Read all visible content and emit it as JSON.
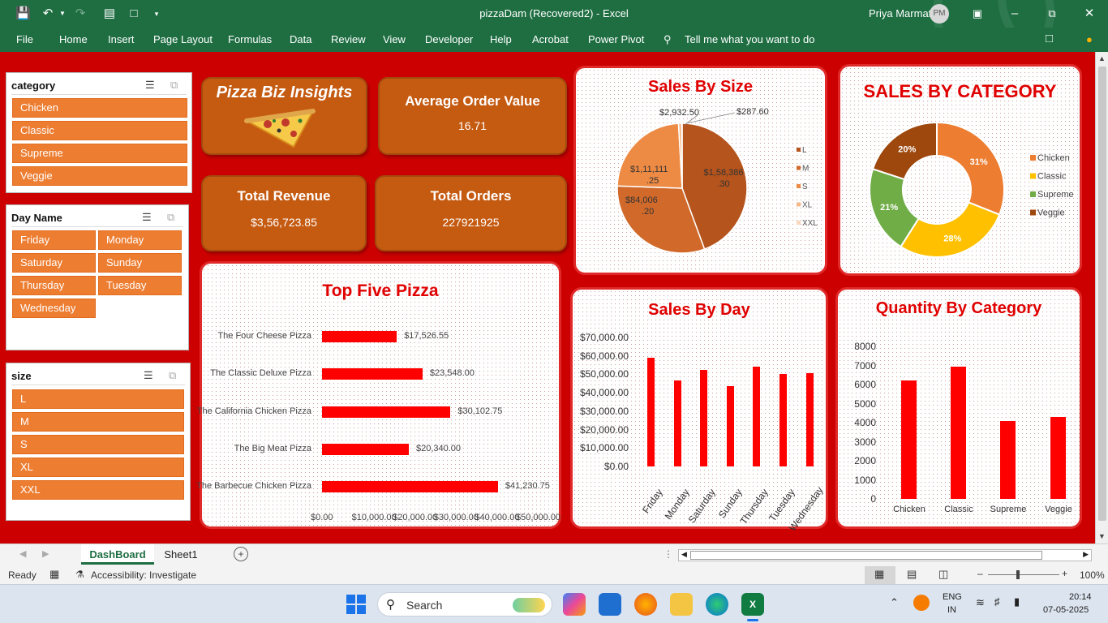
{
  "window": {
    "title": "pizzaDam (Recovered2) - Excel",
    "user": "Priya Marmat",
    "initials": "PM"
  },
  "menu": [
    "File",
    "Home",
    "Insert",
    "Page Layout",
    "Formulas",
    "Data",
    "Review",
    "View",
    "Developer",
    "Help",
    "Acrobat",
    "Power Pivot",
    "Tell me what you want to do"
  ],
  "slicers": {
    "category": {
      "title": "category",
      "items": [
        "Chicken",
        "Classic",
        "Supreme",
        "Veggie"
      ]
    },
    "day": {
      "title": "Day Name",
      "items": [
        "Friday",
        "Monday",
        "Saturday",
        "Sunday",
        "Thursday",
        "Tuesday",
        "Wednesday"
      ]
    },
    "size": {
      "title": "size",
      "items": [
        "L",
        "M",
        "S",
        "XL",
        "XXL"
      ]
    }
  },
  "cards": {
    "brand": "Pizza Biz Insights",
    "aov": {
      "title": "Average Order Value",
      "value": "16.71"
    },
    "revenue": {
      "title": "Total Revenue",
      "value": "$3,56,723.85"
    },
    "orders": {
      "title": "Total Orders",
      "value": "227921925"
    }
  },
  "chart_data": [
    {
      "type": "pie",
      "title": "Sales By Size",
      "categories": [
        "L",
        "M",
        "S",
        "XL",
        "XXL"
      ],
      "values": [
        158386.3,
        111111.25,
        84006.2,
        2932.5,
        287.6
      ],
      "data_labels": [
        "$1,58,386.30",
        "$1,11,111.25",
        "$84,006.20",
        "$2,932.50",
        "$287.60"
      ],
      "legend": "right",
      "colors": [
        "#b5541c",
        "#d0692a",
        "#ed8a44",
        "#f6b98a",
        "#f8d9c0"
      ]
    },
    {
      "type": "pie",
      "subtype": "donut",
      "title": "SALES BY CATEGORY",
      "categories": [
        "Chicken",
        "Classic",
        "Supreme",
        "Veggie"
      ],
      "values": [
        31,
        28,
        21,
        20
      ],
      "data_labels": [
        "31%",
        "28%",
        "21%",
        "20%"
      ],
      "legend": "right",
      "colors": [
        "#ed7d31",
        "#ffc000",
        "#70ad47",
        "#9e480e"
      ]
    },
    {
      "type": "bar",
      "orientation": "horizontal",
      "title": "Top  Five Pizza",
      "categories": [
        "The Four Cheese Pizza",
        "The Classic Deluxe Pizza",
        "The California Chicken Pizza",
        "The Big Meat Pizza",
        "The Barbecue Chicken Pizza"
      ],
      "values": [
        17526.55,
        23548.0,
        30102.75,
        20340.0,
        41230.75
      ],
      "data_labels": [
        "$17,526.55",
        "$23,548.00",
        "$30,102.75",
        "$20,340.00",
        "$41,230.75"
      ],
      "xlim": [
        0,
        50000
      ],
      "xticks": [
        "$0.00",
        "$10,000.00",
        "$20,000.00",
        "$30,000.00",
        "$40,000.00",
        "$50,000.00"
      ]
    },
    {
      "type": "bar",
      "title": "Sales By Day",
      "categories": [
        "Friday",
        "Monday",
        "Saturday",
        "Sunday",
        "Thursday",
        "Tuesday",
        "Wednesday"
      ],
      "values": [
        59000,
        46500,
        52500,
        43500,
        54000,
        50000,
        50500
      ],
      "ylim": [
        0,
        70000
      ],
      "yticks": [
        "$0.00",
        "$10,000.00",
        "$20,000.00",
        "$30,000.00",
        "$40,000.00",
        "$50,000.00",
        "$60,000.00",
        "$70,000.00"
      ]
    },
    {
      "type": "bar",
      "title": "Quantity By Category",
      "categories": [
        "Chicken",
        "Classic",
        "Supreme",
        "Veggie"
      ],
      "values": [
        6200,
        6950,
        4100,
        4300
      ],
      "ylim": [
        0,
        8000
      ],
      "yticks": [
        "0",
        "1000",
        "2000",
        "3000",
        "4000",
        "5000",
        "6000",
        "7000",
        "8000"
      ]
    }
  ],
  "sheets": [
    "DashBoard",
    "Sheet1"
  ],
  "status": {
    "ready": "Ready",
    "accessibility": "Accessibility: Investigate",
    "zoom": "100%"
  },
  "taskbar": {
    "search": "Search",
    "lang1": "ENG",
    "lang2": "IN",
    "time": "20:14",
    "date": "07-05-2025"
  },
  "colors": {
    "excel_green": "#1e6e42",
    "sheet_red": "#cc0000",
    "accent_orange": "#c55a11",
    "bar_red": "#ff0000"
  }
}
